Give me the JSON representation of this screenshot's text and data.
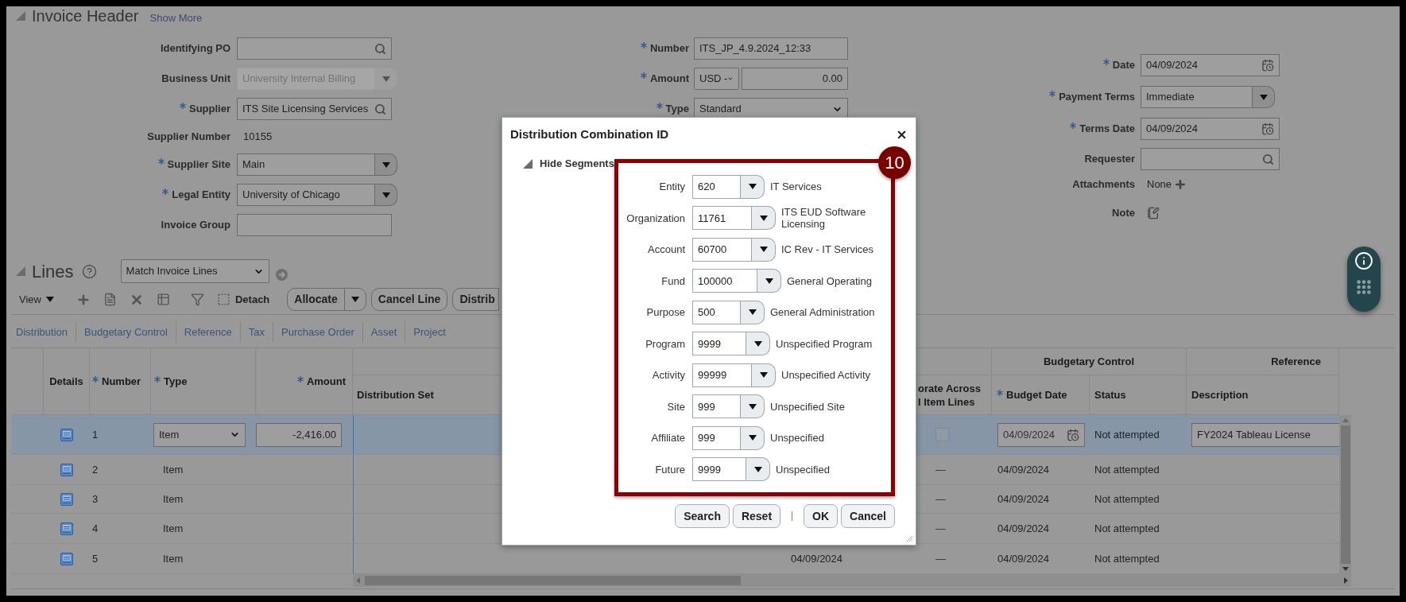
{
  "header": {
    "title": "Invoice Header",
    "show_more": "Show More",
    "left_fields": [
      {
        "label": "Identifying PO",
        "required": false,
        "kind": "search",
        "disabled": false
      },
      {
        "label": "Business Unit",
        "required": false,
        "kind": "select",
        "value": "University Internal Billing",
        "disabled": true
      },
      {
        "label": "Supplier",
        "required": true,
        "kind": "search",
        "value": "ITS Site Licensing Services",
        "disabled": false
      },
      {
        "label": "Supplier Number",
        "required": false,
        "kind": "readonly",
        "value": "10155",
        "disabled": false
      },
      {
        "label": "Supplier Site",
        "required": true,
        "kind": "select",
        "value": "Main",
        "disabled": false
      },
      {
        "label": "Legal Entity",
        "required": true,
        "kind": "select",
        "value": "University of Chicago",
        "disabled": false
      },
      {
        "label": "Invoice Group",
        "required": false,
        "kind": "input",
        "disabled": false
      }
    ],
    "middle_fields": [
      {
        "label": "Number",
        "required": true,
        "kind": "input",
        "value": "ITS_JP_4.9.2024_12:33",
        "disabled": false
      },
      {
        "label": "Amount",
        "required": true,
        "kind": "currency",
        "currency": "USD -",
        "value": "0.00",
        "disabled": false
      },
      {
        "label": "Type",
        "required": true,
        "kind": "native_select",
        "value": "Standard",
        "disabled": false
      }
    ],
    "right_fields": [
      {
        "label": "Date",
        "required": true,
        "kind": "date",
        "value": "04/09/2024",
        "disabled": false
      },
      {
        "label": "Payment Terms",
        "required": true,
        "kind": "select",
        "value": "Immediate",
        "disabled": false
      },
      {
        "label": "Terms Date",
        "required": true,
        "kind": "date",
        "value": "04/09/2024",
        "disabled": false
      },
      {
        "label": "Requester",
        "required": false,
        "kind": "search",
        "disabled": false
      },
      {
        "label": "Attachments",
        "required": false,
        "kind": "attachments",
        "value": "None",
        "disabled": false
      },
      {
        "label": "Note",
        "required": false,
        "kind": "note",
        "disabled": false
      }
    ]
  },
  "lines": {
    "title": "Lines",
    "action_select": "Match Invoice Lines",
    "toolbar": {
      "view": "View",
      "detach": "Detach",
      "buttons": [
        {
          "label": "Allocate",
          "split": true
        },
        {
          "label": "Cancel Line",
          "split": false
        },
        {
          "label": "Distrib",
          "split": false
        }
      ]
    },
    "tabs": [
      "Distribution",
      "Budgetary Control",
      "Reference",
      "Tax",
      "Purchase Order",
      "Asset",
      "Project"
    ],
    "table": {
      "column_groups": [
        "Budgetary Control",
        "Reference"
      ],
      "columns": [
        {
          "label": "Details",
          "required": false
        },
        {
          "label": "Number",
          "required": true
        },
        {
          "label": "Type",
          "required": true
        },
        {
          "label": "Amount",
          "required": true
        },
        {
          "label": "Distribution Set",
          "required": false
        },
        {
          "label": "orate Across\nl Item Lines",
          "required": false
        },
        {
          "label": "Budget Date",
          "required": true
        },
        {
          "label": "Status",
          "required": false
        },
        {
          "label": "Description",
          "required": false
        }
      ],
      "rows": [
        {
          "number": "1",
          "type": "Item",
          "amount": "-2,416.00",
          "selected": true,
          "prorate": {
            "kind": "checkbox",
            "checked": false
          },
          "budget_date": "04/09/2024",
          "status": "Not attempted",
          "description": "FY2024 Tableau License"
        },
        {
          "number": "2",
          "type": "Item",
          "selected": false,
          "prorate": {
            "kind": "text",
            "text": "—"
          },
          "budget_date": "04/09/2024",
          "status": "Not attempted"
        },
        {
          "number": "3",
          "type": "Item",
          "selected": false,
          "prorate": {
            "kind": "text",
            "text": "—"
          },
          "budget_date": "04/09/2024",
          "status": "Not attempted"
        },
        {
          "number": "4",
          "type": "Item",
          "selected": false,
          "prorate": {
            "kind": "text",
            "text": "—"
          },
          "budget_date": "04/09/2024",
          "status": "Not attempted"
        },
        {
          "number": "5",
          "type": "Item",
          "selected": false,
          "column_6": "04/09/2024",
          "prorate": {
            "kind": "text",
            "text": "—"
          },
          "budget_date": "04/09/2024",
          "status": "Not attempted"
        }
      ]
    }
  },
  "dialog": {
    "title": "Distribution Combination ID",
    "toggle": "Hide Segments",
    "expanded": true,
    "step_badge": "10",
    "segments": [
      {
        "label": "Entity",
        "value": "620",
        "description": "IT Services"
      },
      {
        "label": "Organization",
        "value": "11761",
        "description": "ITS EUD Software Licensing"
      },
      {
        "label": "Account",
        "value": "60700",
        "description": "IC Rev - IT Services"
      },
      {
        "label": "Fund",
        "value": "100000",
        "description": "General Operating"
      },
      {
        "label": "Purpose",
        "value": "500",
        "description": "General Administration"
      },
      {
        "label": "Program",
        "value": "9999",
        "description": "Unspecified Program"
      },
      {
        "label": "Activity",
        "value": "99999",
        "description": "Unspecified Activity"
      },
      {
        "label": "Site",
        "value": "999",
        "description": "Unspecified Site"
      },
      {
        "label": "Affiliate",
        "value": "999",
        "description": "Unspecified"
      },
      {
        "label": "Future",
        "value": "9999",
        "description": "Unspecified"
      }
    ],
    "search_buttons": [
      "Search",
      "Reset"
    ],
    "confirm_buttons": [
      "OK",
      "Cancel"
    ]
  }
}
